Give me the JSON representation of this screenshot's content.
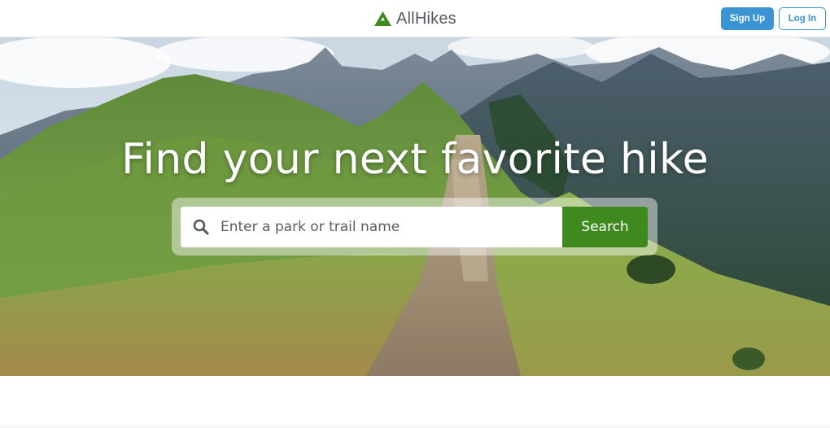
{
  "header": {
    "brand_name": "AllHikes",
    "brand_icon": "mountain-icon",
    "signup_label": "Sign Up",
    "login_label": "Log In"
  },
  "hero": {
    "title": "Find your next favorite hike",
    "search": {
      "placeholder": "Enter a park or trail name",
      "value": "",
      "button_label": "Search",
      "icon": "search-icon"
    },
    "background": "mountain-trail-photo"
  },
  "colors": {
    "brand_green": "#3f8a1f",
    "accent_blue": "#3a94d4"
  }
}
